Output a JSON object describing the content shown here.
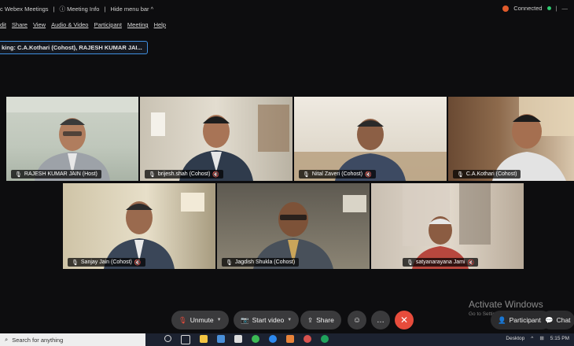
{
  "topbar": {
    "app": "c Webex Meetings",
    "meeting_info": "Meeting Info",
    "hide_menu": "Hide menu bar",
    "status": "Connected"
  },
  "menu": [
    "dit",
    "Share",
    "View",
    "Audio & Video",
    "Participant",
    "Meeting",
    "Help"
  ],
  "speaking": "king: C.A.Kothari (Cohost), RAJESH KUMAR JAI...",
  "participants": [
    {
      "name": "RAJESH KUMAR JAIN  (Host)",
      "muted": false
    },
    {
      "name": "brijesh.shah  (Cohost)",
      "muted": true
    },
    {
      "name": "Nital Zaveri  (Cohost)",
      "muted": true
    },
    {
      "name": "C.A.Kothari  (Cohost)",
      "muted": false
    },
    {
      "name": "Sanjay Jain  (Cohost)",
      "muted": true
    },
    {
      "name": "Jagdish Shukla  (Cohost)",
      "muted": false
    },
    {
      "name": "satyanarayana Jami",
      "muted": true
    }
  ],
  "controls": {
    "unmute": "Unmute",
    "start_video": "Start video",
    "share": "Share",
    "participants": "Participants",
    "chat": "Chat"
  },
  "watermark": {
    "title": "Activate Windows",
    "subtitle": "Go to Settings to activate Windows."
  },
  "taskbar": {
    "search_placeholder": "Search for anything",
    "desktop": "Desktop",
    "time": "5:15 PM"
  }
}
